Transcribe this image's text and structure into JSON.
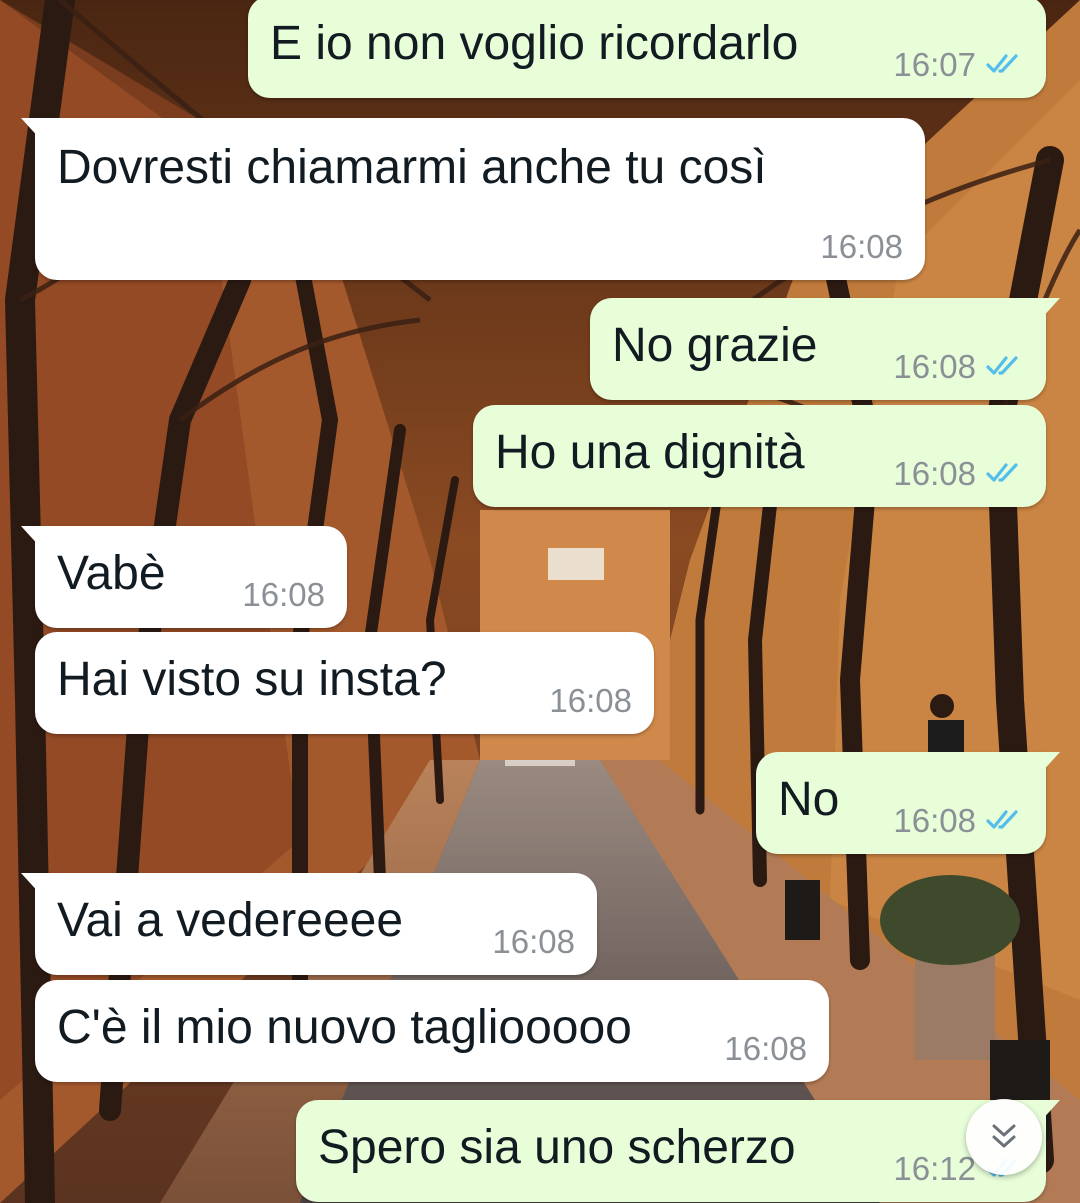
{
  "messages": [
    {
      "id": "m1",
      "direction": "out",
      "text": "E io non voglio ricordarlo",
      "time": "16:07",
      "status": "read"
    },
    {
      "id": "m2",
      "direction": "in",
      "text": "Dovresti chiamarmi anche tu così",
      "time": "16:08"
    },
    {
      "id": "m3",
      "direction": "out",
      "text": "No grazie",
      "time": "16:08",
      "status": "read"
    },
    {
      "id": "m4",
      "direction": "out",
      "text": "Ho una dignità",
      "time": "16:08",
      "status": "read"
    },
    {
      "id": "m5",
      "direction": "in",
      "text": "Vabè",
      "time": "16:08"
    },
    {
      "id": "m6",
      "direction": "in",
      "text": "Hai visto su insta?",
      "time": "16:08"
    },
    {
      "id": "m7",
      "direction": "out",
      "text": "No",
      "time": "16:08",
      "status": "read"
    },
    {
      "id": "m8",
      "direction": "in",
      "text": "Vai a vedereeee",
      "time": "16:08"
    },
    {
      "id": "m9",
      "direction": "in",
      "text": "C'è il mio nuovo tagliooooo",
      "time": "16:08"
    },
    {
      "id": "m10",
      "direction": "out",
      "text": "Spero sia uno scherzo",
      "time": "16:12",
      "status": "read"
    }
  ],
  "colors": {
    "outgoing_bubble": "#e7fed8",
    "incoming_bubble": "#ffffff",
    "read_ticks": "#53bdeb",
    "timestamp": "#8a9096"
  },
  "icons": {
    "read_receipt": "double-check-icon",
    "scroll_down": "double-chevron-down-icon"
  }
}
